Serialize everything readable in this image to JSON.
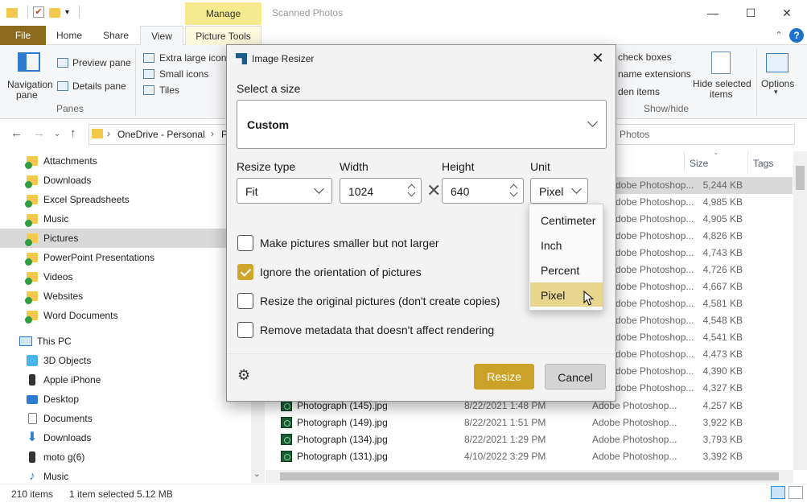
{
  "titlebar": {
    "manage_tab": "Manage",
    "title": "Scanned Photos"
  },
  "tabs": {
    "file": "File",
    "home": "Home",
    "share": "Share",
    "view": "View",
    "picture_tools": "Picture Tools"
  },
  "ribbon": {
    "navigation_pane": "Navigation",
    "navigation_pane2": "pane",
    "preview_pane": "Preview pane",
    "details_pane": "Details pane",
    "panes_group": "Panes",
    "extra_large_icons": "Extra large icons",
    "small_icons": "Small icons",
    "tiles": "Tiles",
    "check_boxes": "check boxes",
    "name_extensions": "name extensions",
    "hidden_items": "den items",
    "hide_selected_1": "Hide selected",
    "hide_selected_2": "items",
    "show_hide_group": "Show/hide",
    "options": "Options"
  },
  "address": {
    "path": "OneDrive - Personal",
    "path_trunc": "P",
    "search": "d Photos"
  },
  "nav": {
    "items": [
      {
        "label": "Attachments"
      },
      {
        "label": "Downloads"
      },
      {
        "label": "Excel Spreadsheets"
      },
      {
        "label": "Music"
      },
      {
        "label": "Pictures"
      },
      {
        "label": "PowerPoint Presentations"
      },
      {
        "label": "Videos"
      },
      {
        "label": "Websites"
      },
      {
        "label": "Word Documents"
      }
    ],
    "this_pc": "This PC",
    "pc_items": [
      {
        "label": "3D Objects"
      },
      {
        "label": "Apple iPhone"
      },
      {
        "label": "Desktop"
      },
      {
        "label": "Documents"
      },
      {
        "label": "Downloads"
      },
      {
        "label": "moto g(6)"
      },
      {
        "label": "Music"
      }
    ]
  },
  "columns": {
    "size": "Size",
    "tags": "Tags"
  },
  "files_partial": [
    {
      "type": "dobe Photoshop...",
      "size": "5,244 KB"
    },
    {
      "type": "dobe Photoshop...",
      "size": "4,985 KB"
    },
    {
      "type": "dobe Photoshop...",
      "size": "4,905 KB"
    },
    {
      "type": "dobe Photoshop...",
      "size": "4,826 KB"
    },
    {
      "type": "dobe Photoshop...",
      "size": "4,743 KB"
    },
    {
      "type": "dobe Photoshop...",
      "size": "4,726 KB"
    },
    {
      "type": "dobe Photoshop...",
      "size": "4,667 KB"
    },
    {
      "type": "dobe Photoshop...",
      "size": "4,581 KB"
    },
    {
      "type": "dobe Photoshop...",
      "size": "4,548 KB"
    },
    {
      "type": "dobe Photoshop...",
      "size": "4,541 KB"
    },
    {
      "type": "dobe Photoshop...",
      "size": "4,473 KB"
    },
    {
      "type": "dobe Photoshop...",
      "size": "4,390 KB"
    },
    {
      "type": "dobe Photoshop...",
      "size": "4,327 KB"
    }
  ],
  "files": [
    {
      "name": "Photograph (145).jpg",
      "date": "8/22/2021 1:48 PM",
      "type": "Adobe Photoshop...",
      "size": "4,257 KB"
    },
    {
      "name": "Photograph (149).jpg",
      "date": "8/22/2021 1:51 PM",
      "type": "Adobe Photoshop...",
      "size": "3,922 KB"
    },
    {
      "name": "Photograph (134).jpg",
      "date": "8/22/2021 1:29 PM",
      "type": "Adobe Photoshop...",
      "size": "3,793 KB"
    },
    {
      "name": "Photograph (131).jpg",
      "date": "4/10/2022 3:29 PM",
      "type": "Adobe Photoshop...",
      "size": "3,392 KB"
    }
  ],
  "status": {
    "count": "210 items",
    "selected": "1 item selected  5.12 MB"
  },
  "dialog": {
    "title": "Image Resizer",
    "select_size_label": "Select a size",
    "size_value": "Custom",
    "resize_type_label": "Resize type",
    "resize_type_value": "Fit",
    "width_label": "Width",
    "width_value": "1024",
    "height_label": "Height",
    "height_value": "640",
    "unit_label": "Unit",
    "unit_value": "Pixel",
    "unit_options": [
      "Centimeter",
      "Inch",
      "Percent",
      "Pixel"
    ],
    "opt_smaller": "Make pictures smaller but not larger",
    "opt_orientation": "Ignore the orientation of pictures",
    "opt_original": "Resize the original pictures (don't create copies)",
    "opt_metadata": "Remove metadata that doesn't affect rendering",
    "resize_btn": "Resize",
    "cancel_btn": "Cancel"
  }
}
